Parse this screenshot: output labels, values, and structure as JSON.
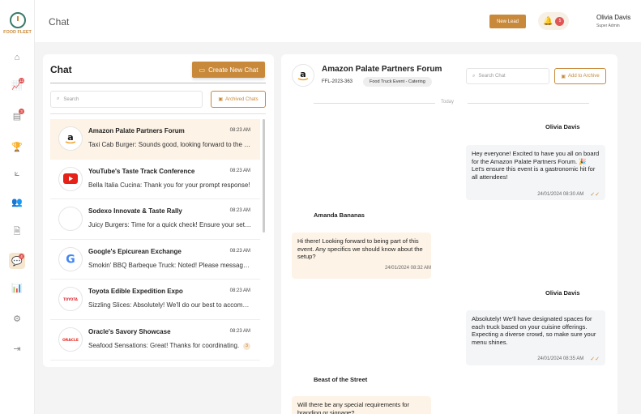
{
  "app": {
    "logo_text": "FOOD FLEET",
    "page_title": "Chat"
  },
  "colors": {
    "accent": "#c8893a",
    "badge": "#e05555",
    "selected_bg": "#fdf3e6"
  },
  "sidebar": {
    "items": [
      {
        "name": "home-icon",
        "glyph": "⌂",
        "badge": ""
      },
      {
        "name": "chart-icon",
        "glyph": "📈",
        "badge": "12"
      },
      {
        "name": "document-icon",
        "glyph": "▤",
        "badge": "3"
      },
      {
        "name": "trophy-icon",
        "glyph": "🏆",
        "badge": ""
      },
      {
        "name": "stats-icon",
        "glyph": "⟀",
        "badge": ""
      },
      {
        "name": "users-icon",
        "glyph": "👥",
        "badge": ""
      },
      {
        "name": "file-icon",
        "glyph": "🗎",
        "badge": ""
      },
      {
        "name": "chat-icon",
        "glyph": "💬",
        "badge": "4"
      },
      {
        "name": "analytics-icon",
        "glyph": "📊",
        "badge": ""
      },
      {
        "name": "settings-icon",
        "glyph": "⚙",
        "badge": ""
      },
      {
        "name": "logout-icon",
        "glyph": "⇥",
        "badge": ""
      }
    ]
  },
  "header": {
    "new_lead": "New Lead",
    "notifications": "5",
    "user_name": "Olivia Davis",
    "user_role": "Super Admin"
  },
  "chat_list": {
    "title": "Chat",
    "create_label": "Create New Chat",
    "search_placeholder": "Search",
    "archived_label": "Archived Chats",
    "items": [
      {
        "name": "Amazon Palate Partners Forum",
        "time": "08:23 AM",
        "msg": "Taxi Cab Burger: Sounds good, looking forward to the event!",
        "avatar": "amazon",
        "unread": ""
      },
      {
        "name": "YouTube's Taste Track Conference",
        "time": "08:23 AM",
        "msg": "Bella Italia Cucina: Thank you for your prompt response!",
        "avatar": "youtube",
        "unread": ""
      },
      {
        "name": "Sodexo Innovate & Taste Rally",
        "time": "08:23 AM",
        "msg": "Juicy Burgers: Time for a quick check! Ensure your setup is ready.",
        "avatar": "blank",
        "unread": ""
      },
      {
        "name": "Google's Epicurean Exchange",
        "time": "08:23 AM",
        "msg": "Smokin' BBQ Barbeque Truck: Noted! Please message me if anything changes.",
        "avatar": "google",
        "unread": ""
      },
      {
        "name": "Toyota Edible Expedition Expo",
        "time": "08:23 AM",
        "msg": "Sizzling Slices: Absolutely! We'll do our best to accommodate.",
        "avatar": "toyota",
        "unread": ""
      },
      {
        "name": "Oracle's Savory Showcase",
        "time": "08:23 AM",
        "msg": "Seafood Sensations: Great! Thanks for coordinating.",
        "avatar": "oracle",
        "unread": "3"
      }
    ]
  },
  "conversation": {
    "title": "Amazon Palate Partners Forum",
    "id": "FFL-2023-363",
    "tag": "Food Truck Event - Catering",
    "search_placeholder": "Search Chat",
    "archive_label": "Add to Archive",
    "day_label": "Today",
    "messages": [
      {
        "sender": "Olivia Davis",
        "text": "Hey everyone! Excited to have you all on board for the Amazon Palate Partners Forum. 🎉 Let's ensure this event is a gastronomic hit for all attendees!",
        "time": "24/01/2024 08:30 AM",
        "dir": "out"
      },
      {
        "sender": "Amanda Bananas",
        "text": "Hi there! Looking forward to being part of this event. Any specifics we should know about the setup?",
        "time": "24/01/2024 08:32 AM",
        "dir": "in"
      },
      {
        "sender": "Olivia Davis",
        "text": "Absolutely! We'll have designated spaces for each truck based on your cuisine offerings. Expecting a diverse crowd, so make sure your menu shines.",
        "time": "24/01/2024 08:35 AM",
        "dir": "out"
      },
      {
        "sender": "Beast of the Street",
        "text": "Will there be any special requirements for branding or signage?",
        "time": "",
        "dir": "in"
      }
    ]
  }
}
